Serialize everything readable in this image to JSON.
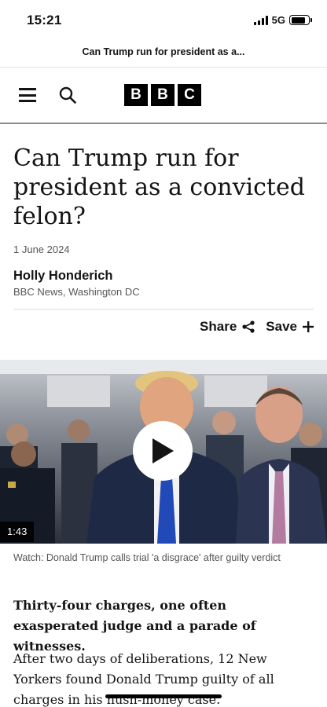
{
  "status_bar": {
    "time": "15:21",
    "network": "5G",
    "battery_level": 0.85
  },
  "browser": {
    "page_title": "Can Trump run for president as a..."
  },
  "header": {
    "logo_letters": [
      "B",
      "B",
      "C"
    ],
    "menu_icon": "hamburger-icon",
    "search_icon": "search-icon"
  },
  "article": {
    "headline": "Can Trump run for president as a convicted felon?",
    "date": "1 June 2024",
    "author": "Holly Honderich",
    "author_role": "BBC News, Washington DC",
    "share_label": "Share",
    "save_label": "Save",
    "video": {
      "duration": "1:43",
      "caption": "Watch: Donald Trump calls trial 'a disgrace' after guilty verdict"
    },
    "intro": "Thirty-four charges, one often exasperated judge and a parade of witnesses.",
    "body": "After two days of deliberations, 12 New Yorkers found Donald Trump guilty of all charges in his hush-money case."
  },
  "colors": {
    "text": "#141414",
    "muted": "#545658",
    "logo_bg": "#000000"
  }
}
